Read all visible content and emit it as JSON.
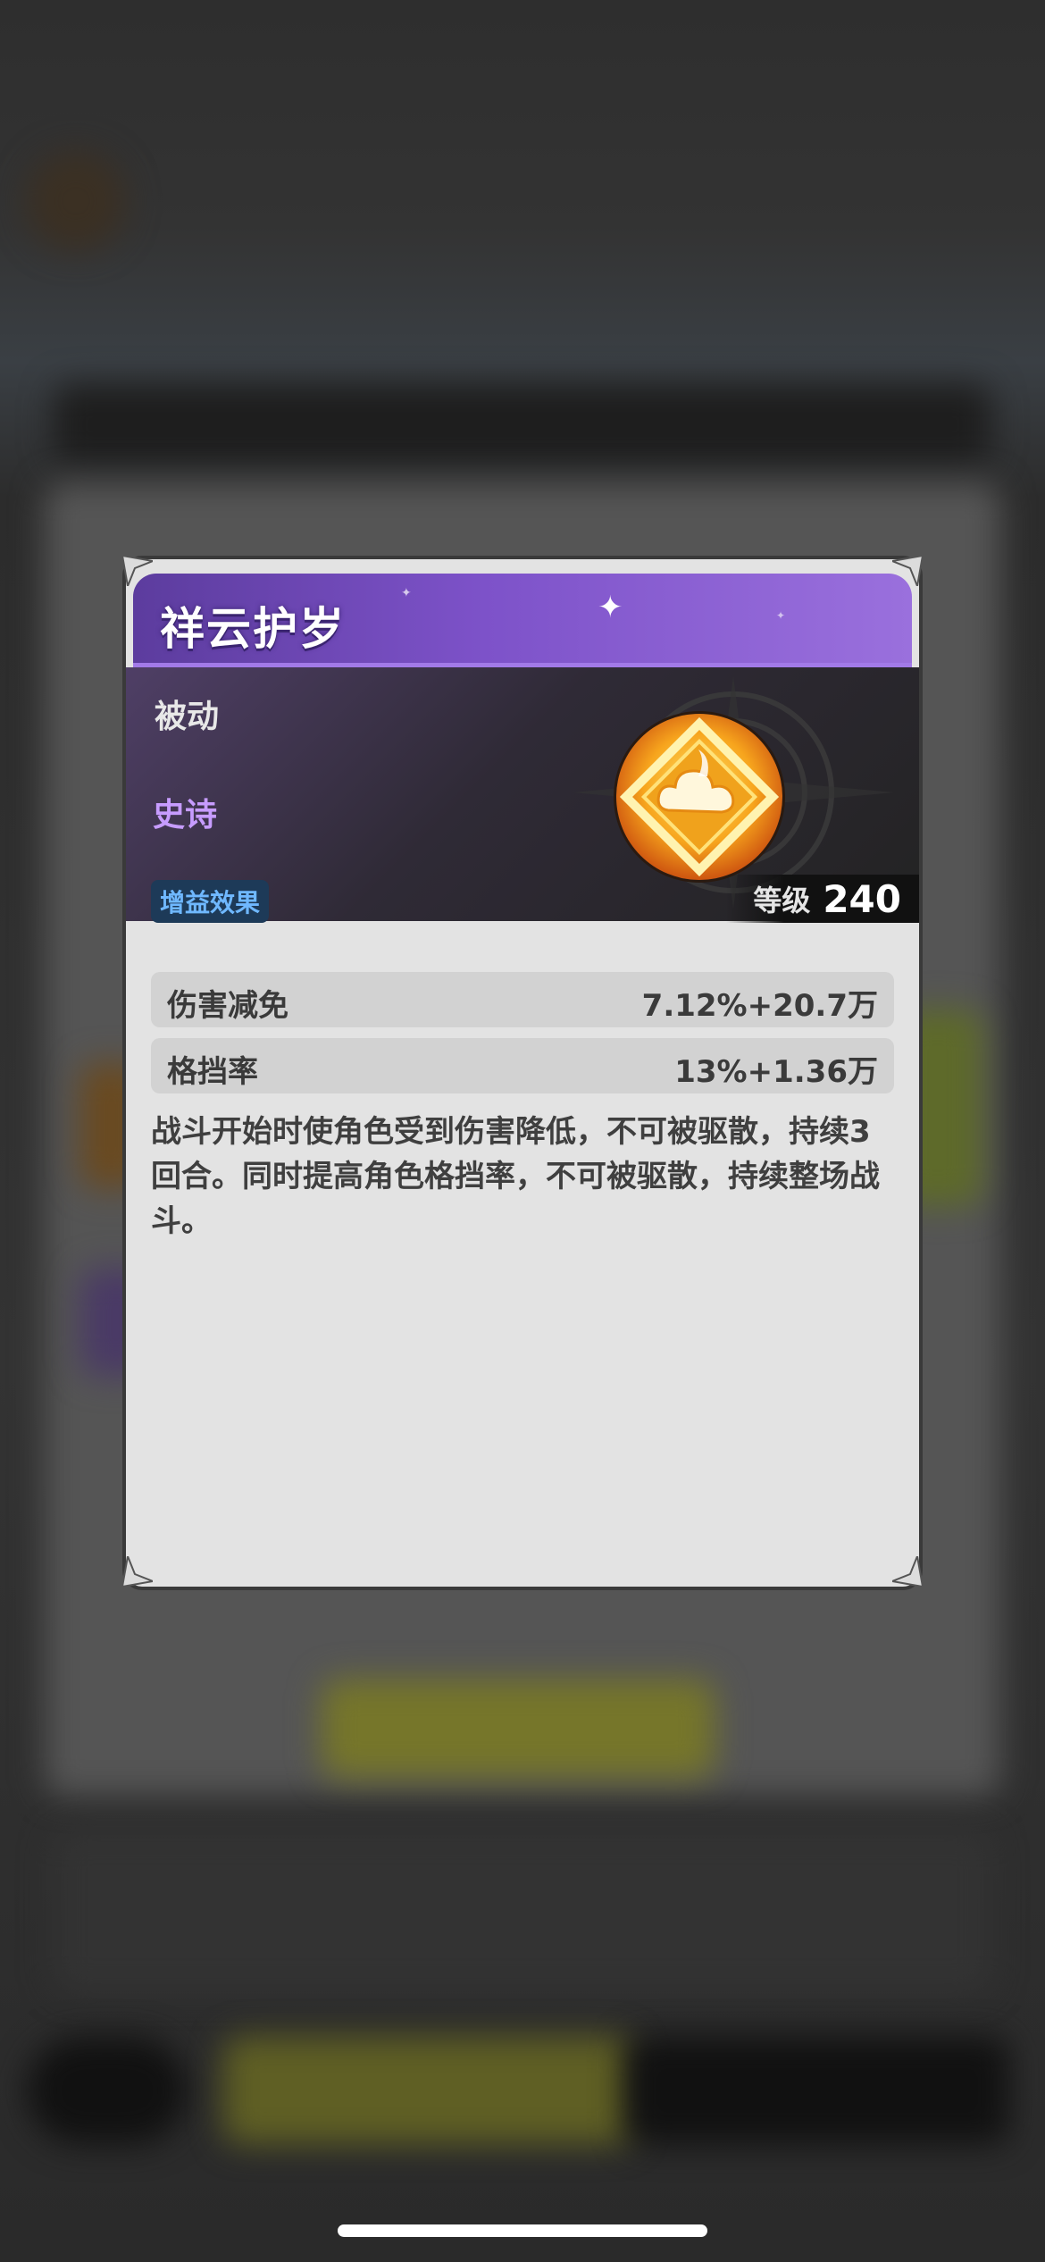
{
  "skill": {
    "name": "祥云护岁",
    "type": "被动",
    "rarity": "史诗",
    "tag": "增益效果",
    "level_label": "等级",
    "level_value": "240",
    "icon": "golden-cloud-icon"
  },
  "stats": [
    {
      "name": "伤害减免",
      "value": "7.12%+20.7万"
    },
    {
      "name": "格挡率",
      "value": "13%+1.36万"
    }
  ],
  "description": "战斗开始时使角色受到伤害降低，不可被驱散，持续3回合。同时提高角色格挡率，不可被驱散，持续整场战斗。",
  "colors": {
    "title_purple": "#7d52c9",
    "rarity_purple": "#c79cff",
    "tag_blue": "#6fb8ff",
    "panel_bg": "#e3e3e3"
  }
}
